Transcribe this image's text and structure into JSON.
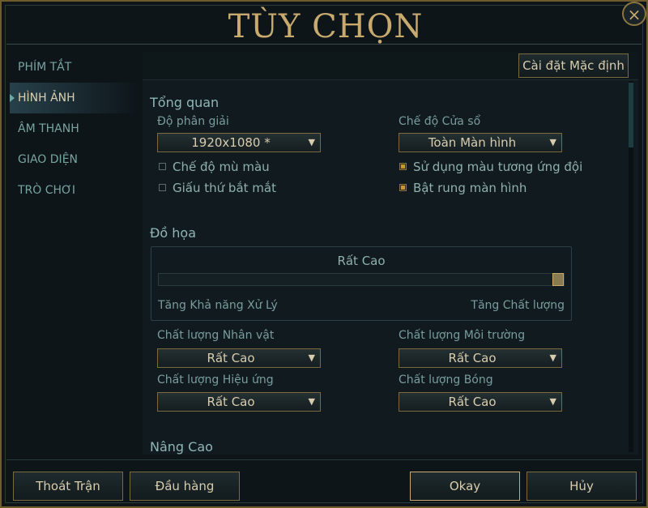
{
  "window": {
    "title": "TÙY CHỌN",
    "close_glyph": "×"
  },
  "sidebar": {
    "items": [
      {
        "label": "PHÍM TẮT",
        "active": false
      },
      {
        "label": "HÌNH ẢNH",
        "active": true
      },
      {
        "label": "ÂM THANH",
        "active": false
      },
      {
        "label": "GIAO DIỆN",
        "active": false
      },
      {
        "label": "TRÒ CHƠI",
        "active": false
      }
    ]
  },
  "panel": {
    "default_button": "Cài đặt Mặc định",
    "overview": {
      "title": "Tổng quan",
      "resolution_label": "Độ phân giải",
      "resolution_value": "1920x1080 *",
      "window_mode_label": "Chế độ Cửa sổ",
      "window_mode_value": "Toàn Màn hình",
      "checkboxes": [
        {
          "label": "Chế độ mù màu",
          "checked": false
        },
        {
          "label": "Giấu thứ bắt mắt",
          "checked": false
        },
        {
          "label": "Sử dụng màu tương ứng đội",
          "checked": true
        },
        {
          "label": "Bật rung màn hình",
          "checked": true
        }
      ]
    },
    "graphics": {
      "title": "Đồ họa",
      "quality_label": "Rất Cao",
      "slider_fraction": 1.0,
      "left_hint": "Tăng Khả năng Xử Lý",
      "right_hint": "Tăng Chất lượng",
      "character_label": "Chất lượng Nhân vật",
      "character_value": "Rất Cao",
      "environment_label": "Chất lượng Môi trường",
      "environment_value": "Rất Cao",
      "effects_label": "Chất lượng Hiệu ứng",
      "effects_value": "Rất Cao",
      "shadow_label": "Chất lượng Bóng",
      "shadow_value": "Rất Cao"
    },
    "advanced": {
      "title": "Nâng Cao"
    }
  },
  "footer": {
    "leave": "Thoát Trận",
    "surrender": "Đầu hàng",
    "okay": "Okay",
    "cancel": "Hủy"
  },
  "colors": {
    "gold": "#c8aa6e",
    "teal": "#78a4a0",
    "checked": "#c89a2a"
  },
  "icons": {
    "dropdown": "triangle-down-icon",
    "close": "close-icon"
  }
}
